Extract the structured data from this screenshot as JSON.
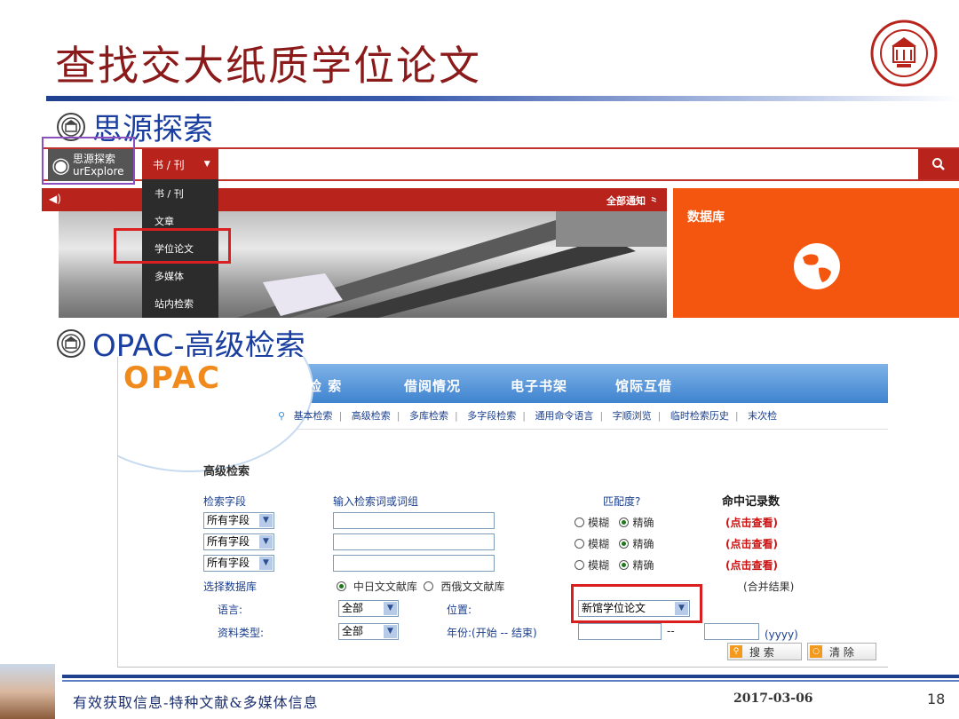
{
  "slide": {
    "title": "查找交大纸质学位论文",
    "bullet1": "思源探索",
    "bullet2": "OPAC-高级检索"
  },
  "siyuan": {
    "logo_line1": "思源探索",
    "logo_line2": "urExplore",
    "select_value": "书 / 刊",
    "menu_items": [
      "书 / 刊",
      "文章",
      "学位论文",
      "多媒体",
      "站内检索"
    ],
    "notice_all": "全部通知 ⺀",
    "panel_label": "数据库"
  },
  "opac": {
    "logo": "OPAC",
    "nav": [
      "检 索",
      "借阅情况",
      "电子书架",
      "馆际互借"
    ],
    "subnav": [
      "基本检索",
      "高级检索",
      "多库检索",
      "多字段检索",
      "通用命令语言",
      "字顺浏览",
      "临时检索历史",
      "末次检"
    ],
    "section_title": "高级检索",
    "col_field": "检索字段",
    "col_input": "输入检索词或词组",
    "col_match": "匹配度?",
    "col_hits": "命中记录数",
    "field_value": "所有字段",
    "match_fuzzy": "模糊",
    "match_exact": "精确",
    "hits_link": "(点击查看)",
    "db_label": "选择数据库",
    "db_cn": "中日文文献库",
    "db_west": "西俄文文献库",
    "merge": "(合并结果)",
    "lang_label": "语言:",
    "lang_value": "全部",
    "location_label": "位置:",
    "location_value": "新馆学位论文",
    "type_label": "资料类型:",
    "type_value": "全部",
    "year_label": "年份:(开始  -- 结束)",
    "year_sep": "--",
    "year_hint": "(yyyy)",
    "search_btn": "搜 索",
    "clear_btn": "清 除"
  },
  "footer": {
    "text": "有效获取信息-特种文献&多媒体信息",
    "date": "2017-03-06",
    "page": "18"
  },
  "colors": {
    "title": "#8b1a1a",
    "bullet": "#1a3fa0",
    "siyuan_red": "#b8231c",
    "db_orange": "#f5560f",
    "highlight": "#d91f1f"
  }
}
